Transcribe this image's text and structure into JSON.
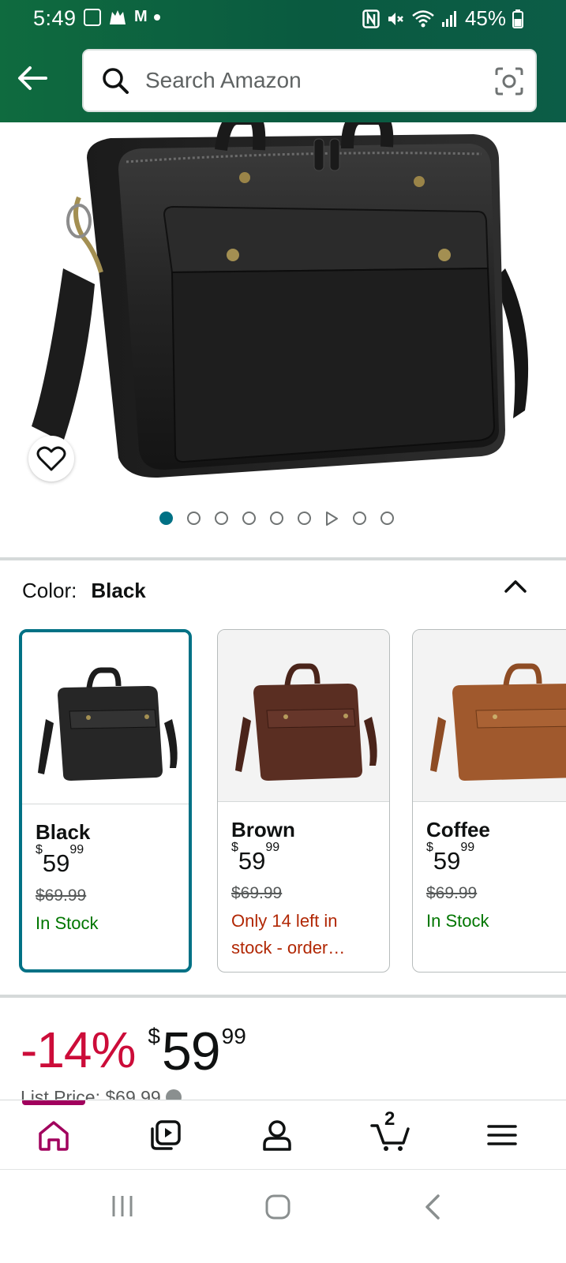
{
  "status_bar": {
    "time": "5:49",
    "notification_letter": "M",
    "battery": "45%"
  },
  "search": {
    "placeholder": "Search Amazon"
  },
  "gallery": {
    "image_count": 9,
    "active_index": 0,
    "video_index": 6
  },
  "color_selector": {
    "label": "Color:",
    "selected": "Black",
    "options": [
      {
        "name": "Black",
        "price_whole": "59",
        "price_fraction": "99",
        "currency": "$",
        "list_price": "$69.99",
        "availability": "In Stock",
        "selected": true
      },
      {
        "name": "Brown",
        "price_whole": "59",
        "price_fraction": "99",
        "currency": "$",
        "list_price": "$69.99",
        "availability": "Only 14 left in stock - order…",
        "selected": false
      },
      {
        "name": "Coffee",
        "price_whole": "59",
        "price_fraction": "99",
        "currency": "$",
        "list_price": "$69.99",
        "availability": "In Stock",
        "selected": false
      }
    ]
  },
  "deal": {
    "discount": "-14%",
    "currency": "$",
    "price_whole": "59",
    "price_fraction": "99",
    "list_price_text": "List Price: $69.99"
  },
  "bottom_nav": {
    "cart_count": "2",
    "items": [
      "home-icon",
      "inspire-icon",
      "account-icon",
      "cart-icon",
      "menu-icon"
    ]
  },
  "colors": {
    "header": "#0a5a40",
    "accent_teal": "#007185",
    "deal_red": "#cc0c39",
    "in_stock": "#007600",
    "low_stock": "#b12704",
    "nav_active": "#a1005d"
  }
}
